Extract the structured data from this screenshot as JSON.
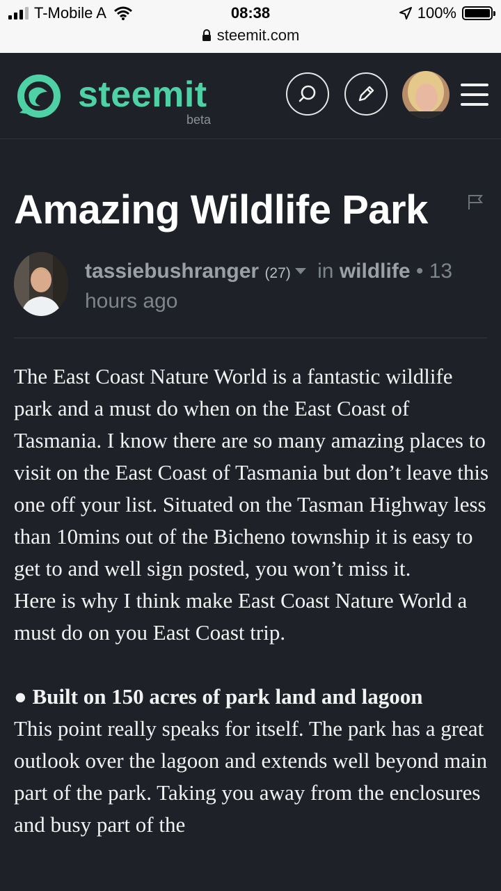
{
  "status_bar": {
    "carrier": "T-Mobile A",
    "time": "08:38",
    "battery": "100%",
    "battery_level": 1.0,
    "url": "steemit.com"
  },
  "header": {
    "logo_text": "steemit",
    "beta_label": "beta",
    "icons": [
      "search-icon",
      "pencil-icon",
      "avatar",
      "hamburger-menu-icon"
    ]
  },
  "post": {
    "title": "Amazing Wildlife Park",
    "author": "tassiebushranger",
    "reputation": "(27)",
    "in_label": "in",
    "category": "wildlife",
    "time_ago": "13 hours ago",
    "paragraph_1": "The East Coast Nature World is a fantastic wildlife park and a must do when on the East Coast of Tasmania. I know there are so many amazing places to visit on the East Coast of Tasmania but don’t leave this one off your list. Situated on the Tasman Highway less than 10mins out of the Bicheno township it is easy to get to and well sign posted, you won’t miss it.",
    "paragraph_2": "Here is why I think make East Coast Nature World a must do on you East Coast trip.",
    "bullet_heading": "● Built on 150 acres of park land and lagoon",
    "paragraph_3": "This point really speaks for itself. The park has a great outlook over the lagoon and extends well beyond main part of the park. Taking you away from the enclosures and busy part of the"
  },
  "colors": {
    "background": "#1e2228",
    "accent": "#4fd1a6"
  }
}
